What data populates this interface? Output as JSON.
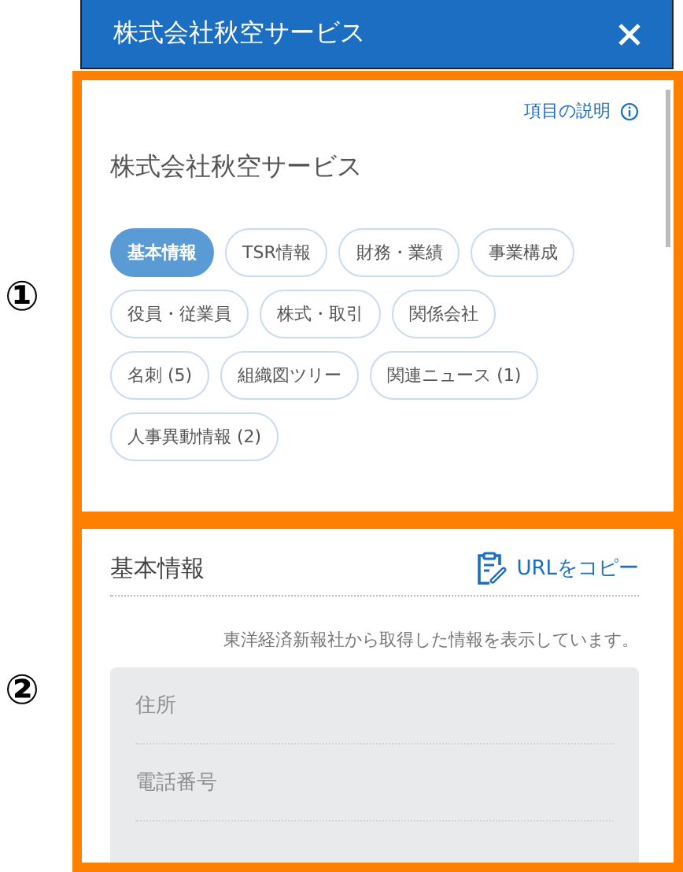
{
  "annotations": [
    "①",
    "②"
  ],
  "header": {
    "title": "株式会社秋空サービス"
  },
  "overview": {
    "help_link": "項目の説明",
    "company_name": "株式会社秋空サービス",
    "tabs": [
      {
        "label": "基本情報",
        "selected": true
      },
      {
        "label": "TSR情報",
        "selected": false
      },
      {
        "label": "財務・業績",
        "selected": false
      },
      {
        "label": "事業構成",
        "selected": false
      },
      {
        "label": "役員・従業員",
        "selected": false
      },
      {
        "label": "株式・取引",
        "selected": false
      },
      {
        "label": "関係会社",
        "selected": false
      },
      {
        "label": "名刺 (5)",
        "selected": false
      },
      {
        "label": "組織図ツリー",
        "selected": false
      },
      {
        "label": "関連ニュース (1)",
        "selected": false
      },
      {
        "label": "人事異動情報 (2)",
        "selected": false
      }
    ]
  },
  "detail": {
    "heading": "基本情報",
    "copy_link": "URLをコピー",
    "note": "東洋経済新報社から取得した情報を表示しています。",
    "fields": [
      {
        "label": "住所"
      },
      {
        "label": "電話番号"
      }
    ]
  }
}
